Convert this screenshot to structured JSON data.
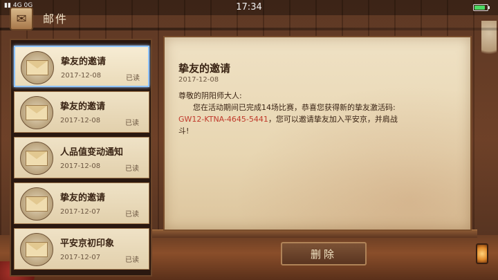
{
  "status_bar": {
    "signal": "4G",
    "network": "4G 0G",
    "time": "17:34",
    "battery_level": 0.85
  },
  "header": {
    "title": "邮件",
    "icon": "mail-tab-icon"
  },
  "mail_list": [
    {
      "title": "挚友的邀请",
      "date": "2017-12-08",
      "status": "已读",
      "selected": true
    },
    {
      "title": "挚友的邀请",
      "date": "2017-12-08",
      "status": "已读",
      "selected": false
    },
    {
      "title": "人品值变动通知",
      "date": "2017-12-08",
      "status": "已读",
      "selected": false
    },
    {
      "title": "挚友的邀请",
      "date": "2017-12-07",
      "status": "已读",
      "selected": false
    },
    {
      "title": "平安京初印象",
      "date": "2017-12-07",
      "status": "已读",
      "selected": false
    }
  ],
  "letter": {
    "title": "挚友的邀请",
    "date": "2017-12-08",
    "greeting": "尊敬的阴阳师大人:",
    "line1": "您在活动期间已完成14场比赛，恭喜您获得新的挚友激活码:",
    "code": "GW12-KTNA-4645-5441",
    "line2_after_code": "，您可以邀请挚友加入平安京，并肩战",
    "line3": "斗!"
  },
  "actions": {
    "delete_label": "删除"
  },
  "colors": {
    "code_red": "#c0392b",
    "selected_border": "#8fc4ff",
    "paper": "#efe1c4"
  }
}
